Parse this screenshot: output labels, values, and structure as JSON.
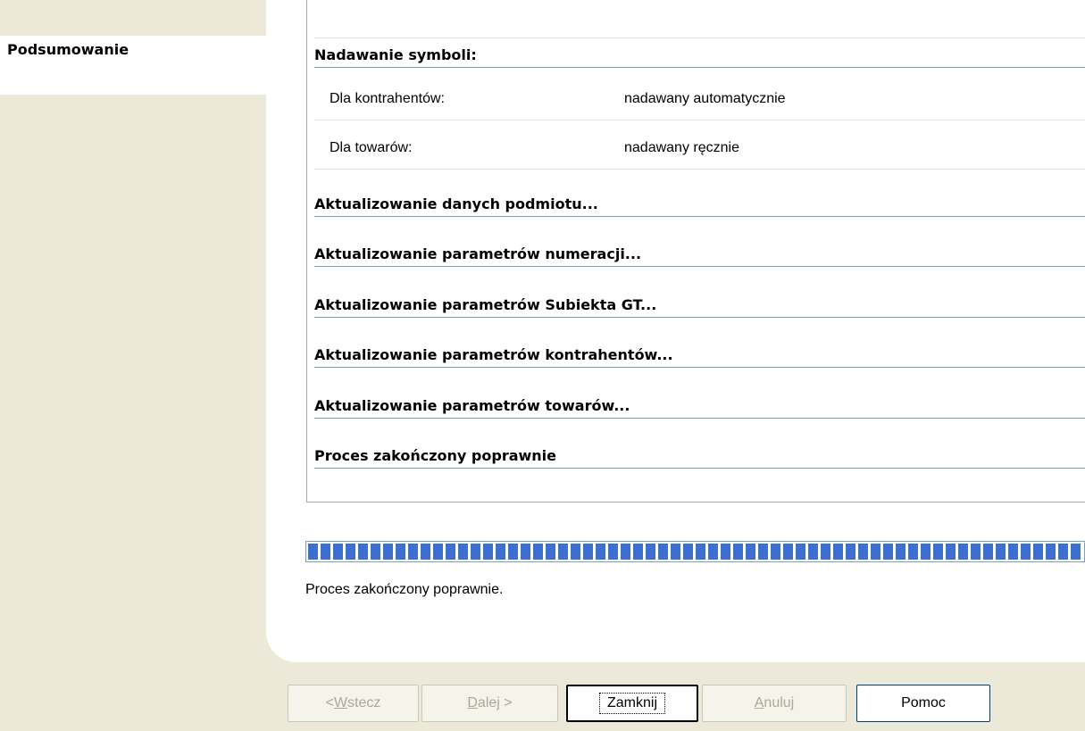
{
  "sidebar": {
    "active_item": "Podsumowanie"
  },
  "log": {
    "symbols_header": "Nadawanie symboli:",
    "symbol_rows": [
      {
        "label": "Dla kontrahentów:",
        "value": "nadawany automatycznie"
      },
      {
        "label": "Dla towarów:",
        "value": "nadawany ręcznie"
      }
    ],
    "steps": [
      "Aktualizowanie danych podmiotu...",
      "Aktualizowanie parametrów numeracji...",
      "Aktualizowanie parametrów Subiekta GT...",
      "Aktualizowanie parametrów kontrahentów...",
      "Aktualizowanie parametrów towarów...",
      "Proces zakończony poprawnie"
    ]
  },
  "progress": {
    "value_percent": 100
  },
  "status_text": "Proces zakończony poprawnie.",
  "buttons": {
    "back": {
      "pre": "< ",
      "acc": "W",
      "post": "stecz"
    },
    "next": {
      "pre": "",
      "acc": "D",
      "post": "alej >"
    },
    "close": "Zamknij",
    "cancel": {
      "pre": "",
      "acc": "A",
      "post": "nuluj"
    },
    "help": "Pomoc"
  },
  "colors": {
    "progress": "#3b6fd1",
    "background": "#ece9d8",
    "border": "#7f9db9"
  }
}
